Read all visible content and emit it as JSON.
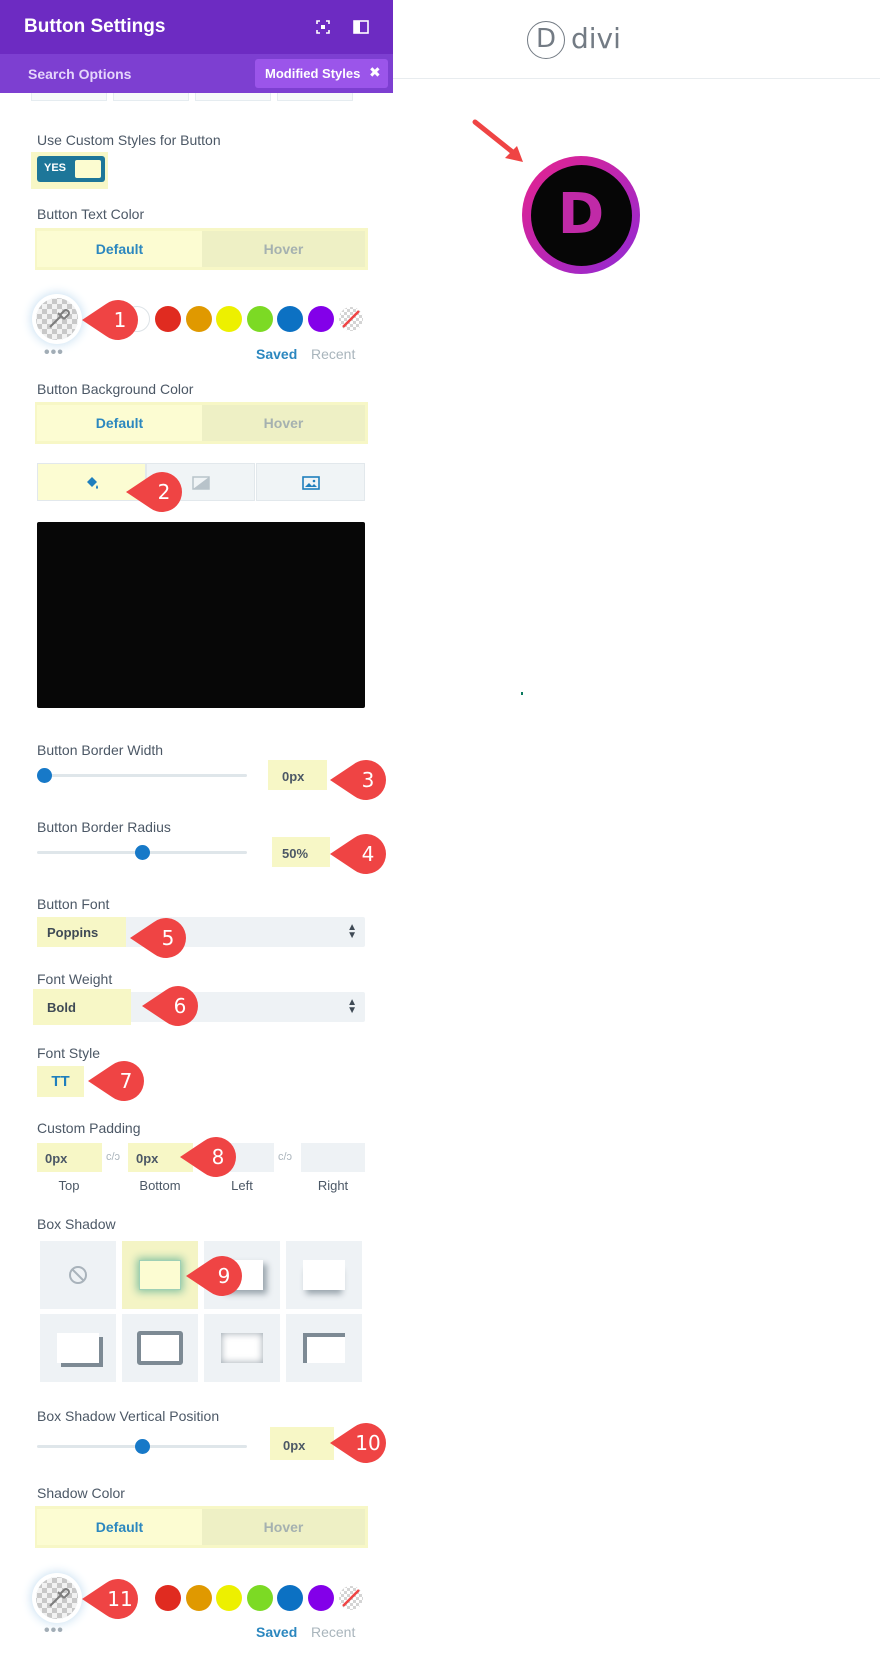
{
  "panel": {
    "title": "Button Settings",
    "search_label": "Search Options",
    "modified_label": "Modified Styles",
    "modified_close": "✖"
  },
  "preview": {
    "logo_letter": "D",
    "logo_text": "divi",
    "button_letter": "D"
  },
  "fields": {
    "custom_styles_label": "Use Custom Styles for Button",
    "custom_styles_toggle": "YES",
    "text_color_label": "Button Text Color",
    "bg_color_label": "Button Background Color",
    "border_width_label": "Button Border Width",
    "border_width_value": "0px",
    "border_width_level": 0,
    "border_radius_label": "Button Border Radius",
    "border_radius_value": "50%",
    "border_radius_level": 0.5,
    "font_label": "Button Font",
    "font_value": "Poppins",
    "weight_label": "Font Weight",
    "weight_value": "Bold",
    "style_label": "Font Style",
    "style_value": "TT",
    "padding_label": "Custom Padding",
    "padding_top": "0px",
    "padding_bottom": "0px",
    "padding_top_label": "Top",
    "padding_bottom_label": "Bottom",
    "padding_left_label": "Left",
    "padding_right_label": "Right",
    "shadow_label": "Box Shadow",
    "shadow_vpos_label": "Box Shadow Vertical Position",
    "shadow_vpos_value": "0px",
    "shadow_vpos_level": 0.5,
    "shadow_color_label": "Shadow Color"
  },
  "common": {
    "default_label": "Default",
    "hover_label": "Hover",
    "saved_label": "Saved",
    "recent_label": "Recent",
    "dots": "•••"
  },
  "swatches": [
    "#e02b20",
    "#e09900",
    "#edf000",
    "#7cda24",
    "#0c71c3",
    "#8300e9"
  ],
  "colors": {
    "header": "#6d2bc2",
    "tabs_bar": "#7d3fd1",
    "accent_blue": "#2b87bf",
    "callout_red": "#ef4444",
    "highlight": "#f7f7c6"
  },
  "callouts": [
    "1",
    "2",
    "3",
    "4",
    "5",
    "6",
    "7",
    "8",
    "9",
    "10",
    "11"
  ]
}
